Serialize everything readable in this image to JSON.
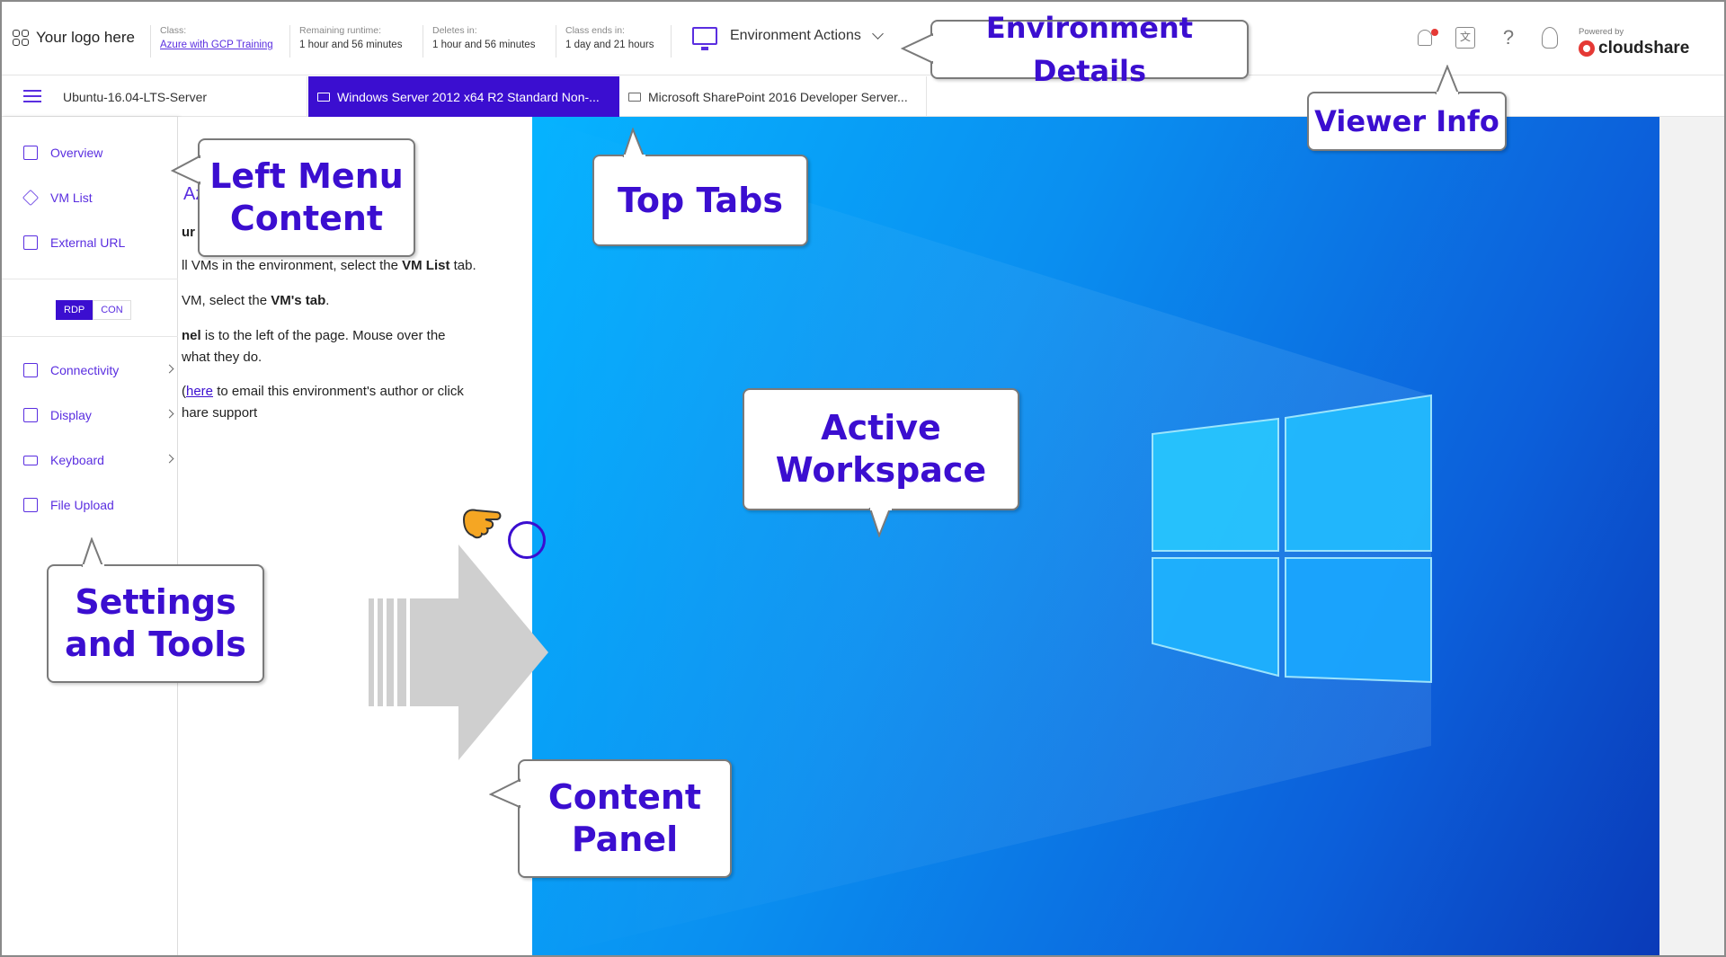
{
  "header": {
    "logo_text": "Your logo here",
    "class_label": "Class:",
    "class_value": "Azure with GCP Training",
    "runtime_label": "Remaining runtime:",
    "runtime_value": "1 hour and 56 minutes",
    "deletes_label": "Deletes in:",
    "deletes_value": "1 hour and 56 minutes",
    "ends_label": "Class ends in:",
    "ends_value": "1 day and 21 hours",
    "env_actions": "Environment Actions",
    "powered_by": "Powered by",
    "brand": "cloudshare"
  },
  "tabs": [
    {
      "label": "Ubuntu-16.04-LTS-Server"
    },
    {
      "label": "Windows Server 2012 x64 R2 Standard Non-..."
    },
    {
      "label": "Microsoft SharePoint 2016 Developer Server..."
    }
  ],
  "left_menu": {
    "items": [
      {
        "label": "Overview"
      },
      {
        "label": "VM List"
      },
      {
        "label": "External URL"
      },
      {
        "label": "Connectivity"
      },
      {
        "label": "Display"
      },
      {
        "label": "Keyboard"
      },
      {
        "label": "File Upload"
      }
    ],
    "toggle": [
      "RDP",
      "CON"
    ]
  },
  "content": {
    "heading": "Az",
    "line1": "ur",
    "line2_pre": "ll VMs in the environment, select the ",
    "line2_bold": "VM List",
    "line2_post": " tab.",
    "line3_pre": "VM, select the ",
    "line3_bold": "VM's tab",
    "line3_post": ".",
    "line4_bold": "nel",
    "line4_post": " is to the left of the page. Mouse over the",
    "line5": "what they do.",
    "line6_pre": "(",
    "line6_link": "here",
    "line6_post": " to email this environment's author or click",
    "line7": "hare support"
  },
  "callouts": {
    "environment_details": "Environment Details",
    "viewer_info": "Viewer Info",
    "top_tabs": "Top Tabs",
    "left_menu_content_1": "Left Menu",
    "left_menu_content_2": "Content",
    "active_workspace_1": "Active",
    "active_workspace_2": "Workspace",
    "settings_tools_1": "Settings",
    "settings_tools_2": "and Tools",
    "content_panel_1": "Content",
    "content_panel_2": "Panel"
  },
  "colors": {
    "accent": "#3b0ed0",
    "workspace_blue": "#0a8ff0",
    "callout_text": "#3b0ed0"
  }
}
